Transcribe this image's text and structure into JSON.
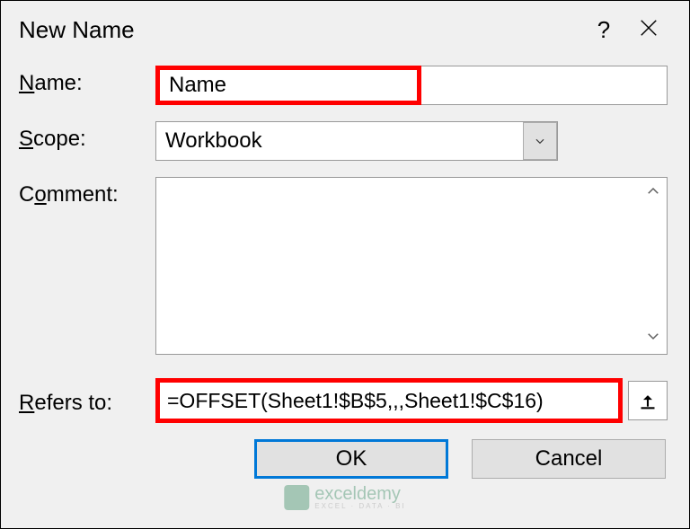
{
  "dialog": {
    "title": "New Name",
    "labels": {
      "name": "Name:",
      "scope": "Scope:",
      "comment": "Comment:",
      "refers_to": "Refers to:"
    },
    "fields": {
      "name_value": "Name",
      "scope_value": "Workbook",
      "comment_value": "",
      "refers_to_value": "=OFFSET(Sheet1!$B$5,,,Sheet1!$C$16)"
    },
    "buttons": {
      "ok": "OK",
      "cancel": "Cancel"
    }
  },
  "watermark": {
    "brand": "exceldemy",
    "tag": "EXCEL · DATA · BI"
  }
}
